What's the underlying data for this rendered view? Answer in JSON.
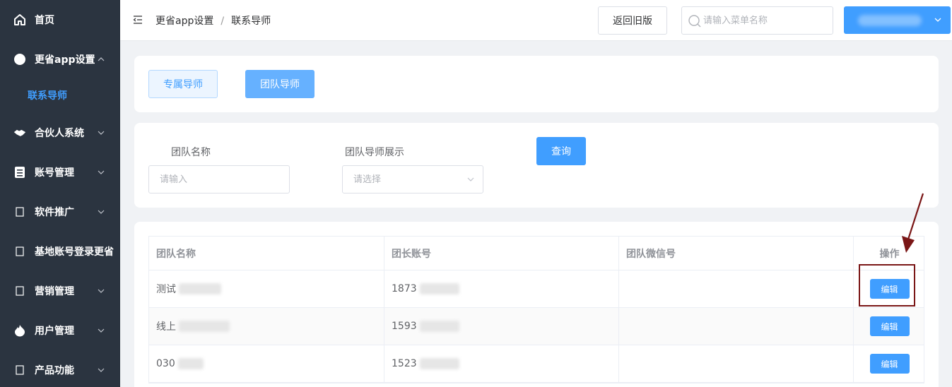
{
  "sidebar": {
    "items": [
      {
        "label": "首页",
        "icon": "home-icon"
      },
      {
        "label": "更省app设置",
        "icon": "circle-icon"
      },
      {
        "label": "合伙人系统",
        "icon": "handshake-icon"
      },
      {
        "label": "账号管理",
        "icon": "document-icon"
      },
      {
        "label": "软件推广",
        "icon": "square-icon"
      },
      {
        "label": "基地账号登录更省",
        "icon": "square-icon"
      },
      {
        "label": "营销管理",
        "icon": "square-icon"
      },
      {
        "label": "用户管理",
        "icon": "flame-icon"
      },
      {
        "label": "产品功能",
        "icon": "square-icon"
      }
    ],
    "sub_item": "联系导师",
    "active_color": "#409eff",
    "bg_color": "#2b3440"
  },
  "header": {
    "breadcrumb": [
      "更省app设置",
      "联系导师"
    ],
    "breadcrumb_sep": "/",
    "old_version_button": "返回旧版",
    "search_placeholder": "请输入菜单名称"
  },
  "tabs": [
    "专属导师",
    "团队导师"
  ],
  "filters": {
    "team_name_label": "团队名称",
    "team_name_placeholder": "请输入",
    "display_label": "团队导师展示",
    "display_placeholder": "请选择",
    "query_button": "查询"
  },
  "table": {
    "columns": [
      "团队名称",
      "团长账号",
      "团队微信号",
      "操作"
    ],
    "rows": [
      {
        "name": "测试",
        "account": "1873",
        "wechat": "",
        "action": "编辑"
      },
      {
        "name": "线上",
        "account": "1593",
        "wechat": "",
        "action": "编辑"
      },
      {
        "name": "030",
        "account": "1523",
        "wechat": "",
        "action": "编辑"
      }
    ]
  },
  "colors": {
    "primary": "#409eff",
    "annotation": "#7a1616"
  }
}
